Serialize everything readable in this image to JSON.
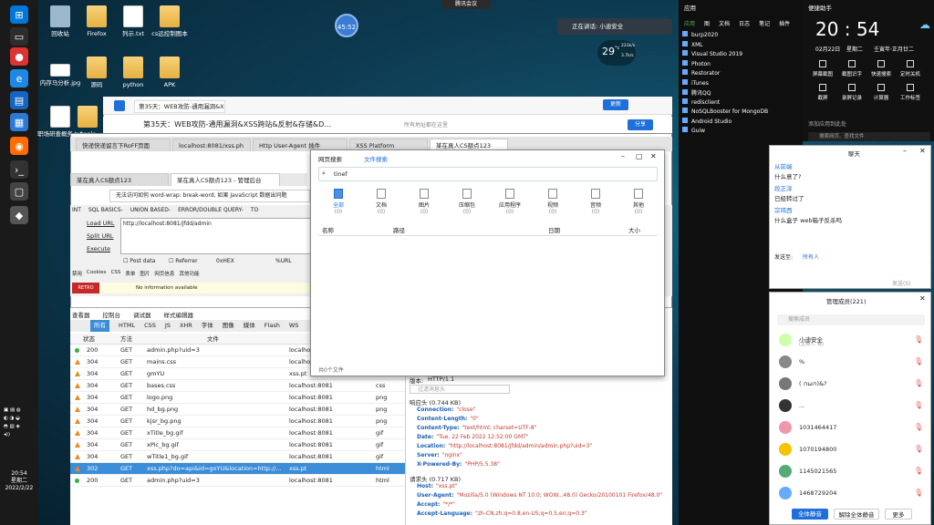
{
  "desktop": {
    "icons": [
      {
        "label": "回收站"
      },
      {
        "label": "Firefox"
      },
      {
        "label": "列示.txt"
      },
      {
        "label": "cs远控制图本"
      },
      {
        "label": "内存马分析.jpg"
      },
      {
        "label": "源码"
      },
      {
        "label": "python"
      },
      {
        "label": "APK"
      },
      {
        "label": "职场研查概务.txt"
      },
      {
        "label": "Applo"
      }
    ]
  },
  "meeting": {
    "label": "腾讯会议"
  },
  "timer": {
    "value": "45:52"
  },
  "speaking": {
    "label": "正在讲话: 小迪安全"
  },
  "weather": {
    "temp": "29",
    "unit": "°c",
    "up": "223k/s",
    "down": "3.7k/s"
  },
  "sogou": {
    "title": "第35天：WEB攻防-通用漏洞&XSS跨站&反射&存储&D...",
    "update": "更新",
    "share": "分享",
    "hint": "所有地址都在这里"
  },
  "fftabs": [
    "快递快递留言下RoFF页面",
    "localhost:8081/xss.ph",
    "Http User-Agent 插件",
    "XSS Platform",
    "某在真人CS额点123"
  ],
  "inner_tabs": [
    "某在真人CS额点123",
    "某在真人CS额点123 - 管理后台"
  ],
  "hackbar": {
    "menu": [
      "INT",
      "SQL BASICS-",
      "UNION BASED-",
      "ERROR/DOUBLE QUERY-",
      "TO"
    ],
    "load": "Load URL",
    "split": "Split URL",
    "exec": "Execute",
    "url": "http://localhost:8081/jfdd/admin",
    "post": "Post data",
    "referrer": "Referrer",
    "hex": "0xHEX",
    "urlenc": "%URL",
    "warning": "无法访问如何 word-wrap: break-word; 如果 JavaScript 数据出问题",
    "toolbar": [
      "禁用",
      "Cookies",
      "CSS",
      "表单",
      "图片",
      "网页信息",
      "其他功能",
      "标记",
      "调整大小",
      "工具",
      "查看源代码",
      "选项"
    ],
    "info": "No information available"
  },
  "devtools": {
    "tabs": [
      "查看器",
      "控制台",
      "调试器",
      "样式编辑器"
    ],
    "filters": [
      "所有",
      "HTML",
      "CSS",
      "JS",
      "XHR",
      "字体",
      "图像",
      "媒体",
      "Flash",
      "WS"
    ],
    "cols": [
      "状态",
      "方法",
      "文件"
    ],
    "rows": [
      {
        "status": "200",
        "method": "GET",
        "file": "admin.php?uid=3",
        "domain": "localho",
        "type": "",
        "dot": "green"
      },
      {
        "status": "304",
        "method": "GET",
        "file": "mains.css",
        "domain": "localho",
        "type": "",
        "dot": "orange"
      },
      {
        "status": "304",
        "method": "GET",
        "file": "gmYU",
        "domain": "xss.pt",
        "type": "",
        "dot": "orange"
      },
      {
        "status": "304",
        "method": "GET",
        "file": "bases.css",
        "domain": "localhost:8081",
        "type": "css",
        "dot": "orange"
      },
      {
        "status": "304",
        "method": "GET",
        "file": "logo.png",
        "domain": "localhost:8081",
        "type": "png",
        "dot": "orange"
      },
      {
        "status": "304",
        "method": "GET",
        "file": "hd_bg.png",
        "domain": "localhost:8081",
        "type": "png",
        "dot": "orange"
      },
      {
        "status": "304",
        "method": "GET",
        "file": "kjsr_bg.png",
        "domain": "localhost:8081",
        "type": "png",
        "dot": "orange"
      },
      {
        "status": "304",
        "method": "GET",
        "file": "xTitle_bg.gif",
        "domain": "localhost:8081",
        "type": "gif",
        "dot": "orange"
      },
      {
        "status": "304",
        "method": "GET",
        "file": "xPic_bg.gif",
        "domain": "localhost:8081",
        "type": "gif",
        "dot": "orange"
      },
      {
        "status": "304",
        "method": "GET",
        "file": "wTitle1_bg.gif",
        "domain": "localhost:8081",
        "type": "gif",
        "dot": "orange"
      },
      {
        "status": "302",
        "method": "GET",
        "file": "xss.php?do=api&id=goYU&location=http://...",
        "domain": "xss.pt",
        "type": "html",
        "dot": "orange"
      },
      {
        "status": "200",
        "method": "GET",
        "file": "admin.php?uid=3",
        "domain": "localhost:8081",
        "type": "html",
        "dot": "green"
      }
    ]
  },
  "headers": {
    "version_label": "版本:",
    "version": "HTTP/1.1",
    "filter": "过滤消息头",
    "resp_title": "响应头 (0.744 KB)",
    "req_title": "请求头 (0.717 KB)",
    "resp": [
      [
        "Connection:",
        "\"close\""
      ],
      [
        "Content-Length:",
        "\"0\""
      ],
      [
        "Content-Type:",
        "\"text/html; charset=UTF-8\""
      ],
      [
        "Date:",
        "\"Tue, 22 Feb 2022 12:52:00 GMT\""
      ],
      [
        "Location:",
        "\"http://localhost:8081/jfdd/admin/admin.php?uid=3\""
      ],
      [
        "Server:",
        "\"nginx\""
      ],
      [
        "X-Powered-By:",
        "\"PHP/5.5.38\""
      ]
    ],
    "req": [
      [
        "Host:",
        "\"xss.pt\""
      ],
      [
        "User-Agent:",
        "\"Mozilla/5.0 (Windows NT 10.0; WOW...48.0) Gecko/20100101 Firefox/48.0\""
      ],
      [
        "Accept:",
        "\"*/*\""
      ],
      [
        "Accept-Language:",
        "\"zh-CN,zh;q=0.8,en-US;q=0.5,en;q=0.3\""
      ]
    ]
  },
  "search": {
    "tabs": [
      "网页搜索",
      "文件搜索"
    ],
    "query": "tinef",
    "cats": [
      "全部",
      "文档",
      "图片",
      "压缩包",
      "应用程序",
      "视频",
      "音频",
      "其他"
    ],
    "counts": [
      "(0)",
      "(0)",
      "(0)",
      "(0)",
      "(0)",
      "(0)",
      "(0)",
      "(0)"
    ],
    "cols": [
      "名称",
      "路径",
      "日期",
      "大小"
    ],
    "footer": "共0个文件"
  },
  "applist": {
    "tabs": [
      "应用",
      "图",
      "文档",
      "日志",
      "笔记",
      "插件"
    ],
    "title": "应用",
    "items": [
      "burp2020",
      "XML",
      "Visual Studio 2019",
      "Photon",
      "Restorator",
      "iTunes",
      "腾讯QQ",
      "redisclient",
      "NoSQLBooster for MongoDB",
      "Android Studio",
      "Guiw"
    ]
  },
  "panel": {
    "title": "便捷助手",
    "time": "20 : 54",
    "date": "02月22日",
    "weekday": "星期二",
    "lunar": "壬寅年·正月廿二",
    "tools": [
      "屏幕截图",
      "截图识字",
      "快速搜索",
      "定时关机",
      "截屏",
      "录屏记录",
      "计算器",
      "工作标签"
    ],
    "hint": "添加应用到此处",
    "search": "搜索网页、查找文件"
  },
  "chat1": {
    "title": "聊天",
    "msgs": [
      [
        "从前端",
        "什么意了?"
      ],
      [
        "段正淳",
        "已经转过了"
      ],
      [
        "宗玮西",
        "什么盒子 web箱子反杀吗"
      ]
    ],
    "to_label": "发送至:",
    "to": "所有人",
    "send": "发送(S)"
  },
  "chat2": {
    "title": "管理成员(221)",
    "search": "搜索成员",
    "users": [
      "小迪安全",
      "%",
      "( ∩ω∩)&?",
      "...",
      "1031464417",
      "1070194800",
      "1145021565",
      "1468729204"
    ],
    "host": "(主持人, 我)",
    "b1": "全体静音",
    "b2": "解除全体静音",
    "b3": "更多"
  },
  "clock": {
    "time": "20:54",
    "day": "星期二",
    "date": "2022/2/22"
  }
}
